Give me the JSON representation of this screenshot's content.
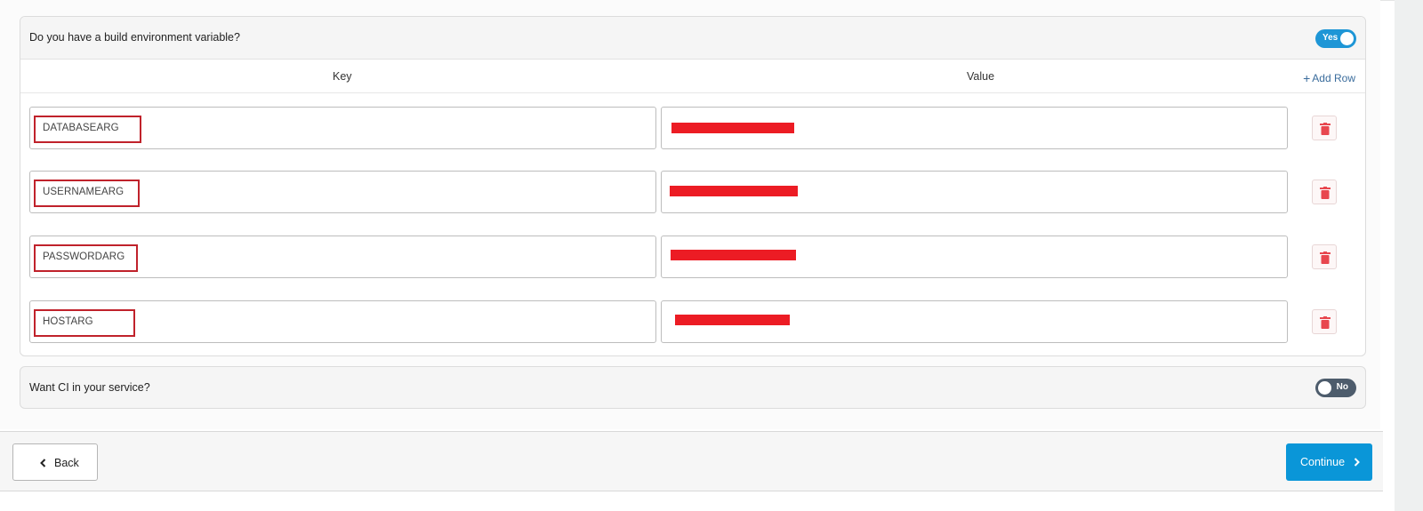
{
  "env_section": {
    "question": "Do you have a build environment variable?",
    "toggle_label": "Yes",
    "toggle_state": "on",
    "columns": {
      "key": "Key",
      "value": "Value"
    },
    "add_row_label": "Add Row",
    "rows": [
      {
        "key": "DATABASEARG",
        "value_redacted": true
      },
      {
        "key": "USERNAMEARG",
        "value_redacted": true
      },
      {
        "key": "PASSWORDARG",
        "value_redacted": true
      },
      {
        "key": "HOSTARG",
        "value_redacted": true
      }
    ]
  },
  "ci_section": {
    "question": "Want CI in your service?",
    "toggle_label": "No",
    "toggle_state": "off"
  },
  "footer": {
    "back_label": "Back",
    "continue_label": "Continue"
  },
  "colors": {
    "accent": "#1e96d6",
    "continue": "#0a96d8",
    "toggle_off": "#4d5c6c",
    "highlight": "#c0222b",
    "redaction": "#ec1c24",
    "trash": "#e8474f"
  },
  "icons": {
    "trash": "trash-icon",
    "back": "chevron-left-icon",
    "continue": "chevron-right-icon",
    "add": "plus-icon"
  }
}
